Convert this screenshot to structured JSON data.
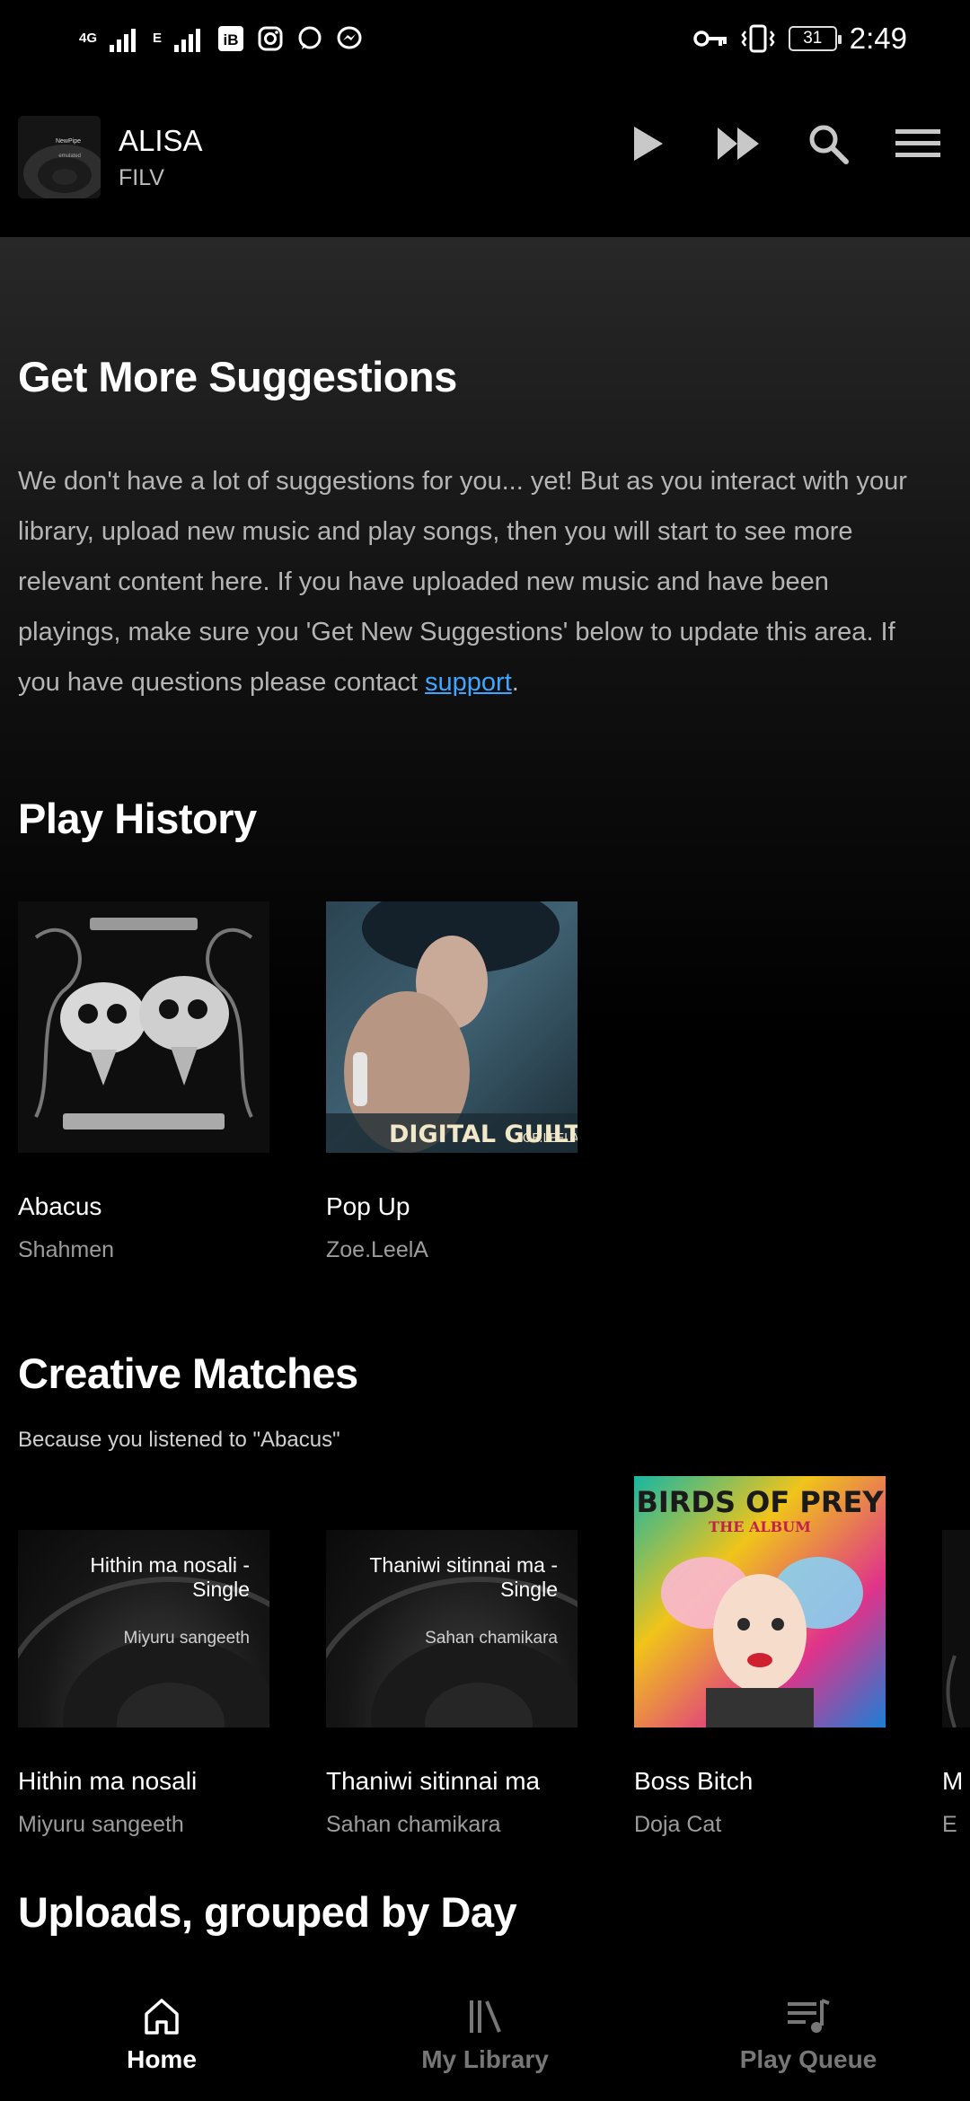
{
  "status_bar": {
    "network_1": "4G",
    "network_2": "E",
    "battery_level": "31",
    "time": "2:49",
    "icons": [
      "signal-icon",
      "signal-icon",
      "ib-icon",
      "instagram-icon",
      "whatsapp-icon",
      "messenger-icon",
      "key-icon",
      "vibrate-icon",
      "battery-icon"
    ]
  },
  "player": {
    "title": "ALISA",
    "artist": "FILV",
    "thumb_text": "NewPipe\nemulated",
    "actions": [
      "play-icon",
      "fast-forward-icon",
      "search-icon",
      "menu-icon"
    ]
  },
  "suggestions": {
    "title": "Get More Suggestions",
    "body": "We don't have a lot of suggestions for you... yet! But as you interact with your library, upload new music and play songs, then you will start to see more relevant content here. If you have uploaded new music and have been playings, make sure you 'Get New Suggestions' below to update this area. If you have questions please contact ",
    "link": "support",
    "end": "."
  },
  "play_history": {
    "title": "Play History",
    "items": [
      {
        "title": "Abacus",
        "artist": "Shahmen"
      },
      {
        "title": "Pop Up",
        "artist": "Zoe.LeelA",
        "art_text": "DIGITAL GUILT ZOE.LEELA"
      }
    ]
  },
  "creative_matches": {
    "title": "Creative Matches",
    "subtitle": "Because you listened to \"Abacus\"",
    "items": [
      {
        "title": "Hithin ma nosali",
        "artist": "Miyuru sangeeth",
        "art_title": "Hithin ma nosali - Single",
        "art_artist": "Miyuru sangeeth"
      },
      {
        "title": "Thaniwi sitinnai ma",
        "artist": "Sahan chamikara",
        "art_title": "Thaniwi sitinnai ma - Single",
        "art_artist": "Sahan chamikara"
      },
      {
        "title": "Boss Bitch",
        "artist": "Doja Cat",
        "art_title": "BIRDS OF PREY",
        "art_sub": "THE ALBUM"
      },
      {
        "title": "M",
        "artist": "E"
      }
    ]
  },
  "uploads": {
    "title": "Uploads, grouped by Day"
  },
  "bottom_nav": {
    "items": [
      {
        "label": "Home",
        "icon": "home-icon",
        "active": true
      },
      {
        "label": "My Library",
        "icon": "library-icon",
        "active": false
      },
      {
        "label": "Play Queue",
        "icon": "queue-icon",
        "active": false
      }
    ]
  }
}
